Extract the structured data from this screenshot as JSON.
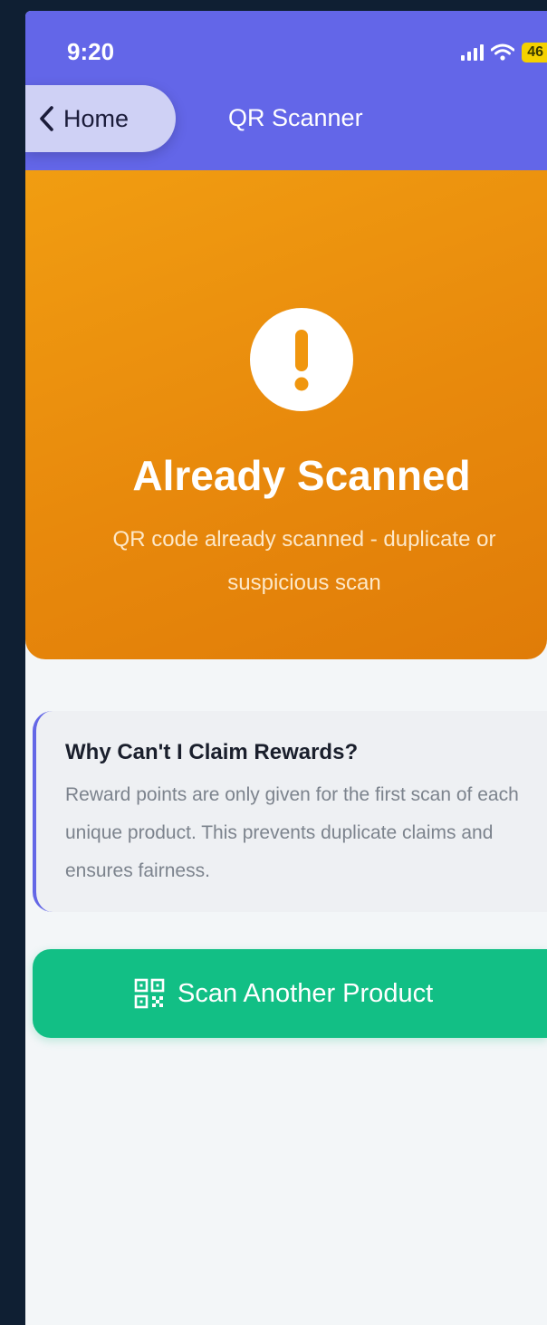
{
  "status_bar": {
    "time": "9:20",
    "battery": "46"
  },
  "nav": {
    "back_label": "Home",
    "title": "QR Scanner"
  },
  "hero": {
    "title": "Already Scanned",
    "subtitle": "QR code already scanned - duplicate or suspicious scan",
    "icon": "exclamation-icon",
    "color": "#F0960E"
  },
  "info_card": {
    "title": "Why Can't I Claim Rewards?",
    "body": "Reward points are only given for the first scan of each unique product. This prevents duplicate claims and ensures fairness.",
    "accent": "#6467E6"
  },
  "actions": {
    "scan_another_label": "Scan Another Product",
    "icon": "qr-code-icon",
    "color": "#12BF85"
  },
  "colors": {
    "header": "#6366E8",
    "background": "#F3F6F8"
  }
}
